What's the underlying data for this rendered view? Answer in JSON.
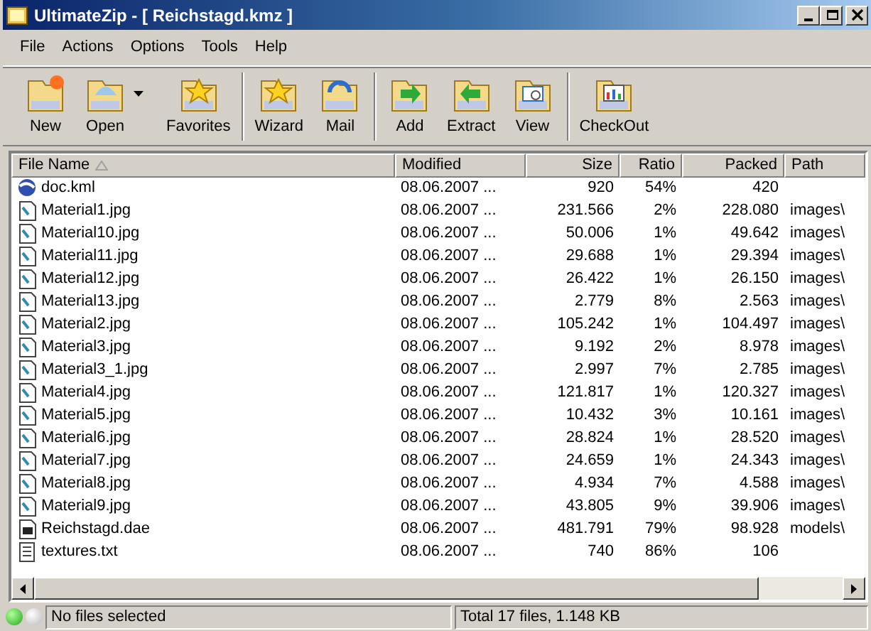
{
  "window": {
    "title": "UltimateZip - [ Reichstagd.kmz ]"
  },
  "menu": [
    "File",
    "Actions",
    "Options",
    "Tools",
    "Help"
  ],
  "toolbar": [
    [
      {
        "label": "New",
        "dropdown": false
      },
      {
        "label": "Open",
        "dropdown": true
      },
      {
        "label": "Favorites",
        "dropdown": false
      }
    ],
    [
      {
        "label": "Wizard",
        "dropdown": false
      },
      {
        "label": "Mail",
        "dropdown": false
      }
    ],
    [
      {
        "label": "Add",
        "dropdown": false
      },
      {
        "label": "Extract",
        "dropdown": false
      },
      {
        "label": "View",
        "dropdown": false
      }
    ],
    [
      {
        "label": "CheckOut",
        "dropdown": false
      }
    ]
  ],
  "table": {
    "columns": [
      {
        "label": "File Name",
        "sorted": true
      },
      {
        "label": "Modified",
        "sorted": false
      },
      {
        "label": "Size",
        "sorted": false
      },
      {
        "label": "Ratio",
        "sorted": false
      },
      {
        "label": "Packed",
        "sorted": false
      },
      {
        "label": "Path",
        "sorted": false
      }
    ],
    "rows": [
      {
        "kind": "kml",
        "cells": [
          "doc.kml",
          "08.06.2007 ...",
          "920",
          "54%",
          "420",
          null
        ]
      },
      {
        "kind": "jpg",
        "cells": [
          "Material1.jpg",
          "08.06.2007 ...",
          "231.566",
          "2%",
          "228.080",
          "images\\"
        ]
      },
      {
        "kind": "jpg",
        "cells": [
          "Material10.jpg",
          "08.06.2007 ...",
          "50.006",
          "1%",
          "49.642",
          "images\\"
        ]
      },
      {
        "kind": "jpg",
        "cells": [
          "Material11.jpg",
          "08.06.2007 ...",
          "29.688",
          "1%",
          "29.394",
          "images\\"
        ]
      },
      {
        "kind": "jpg",
        "cells": [
          "Material12.jpg",
          "08.06.2007 ...",
          "26.422",
          "1%",
          "26.150",
          "images\\"
        ]
      },
      {
        "kind": "jpg",
        "cells": [
          "Material13.jpg",
          "08.06.2007 ...",
          "2.779",
          "8%",
          "2.563",
          "images\\"
        ]
      },
      {
        "kind": "jpg",
        "cells": [
          "Material2.jpg",
          "08.06.2007 ...",
          "105.242",
          "1%",
          "104.497",
          "images\\"
        ]
      },
      {
        "kind": "jpg",
        "cells": [
          "Material3.jpg",
          "08.06.2007 ...",
          "9.192",
          "2%",
          "8.978",
          "images\\"
        ]
      },
      {
        "kind": "jpg",
        "cells": [
          "Material3_1.jpg",
          "08.06.2007 ...",
          "2.997",
          "7%",
          "2.785",
          "images\\"
        ]
      },
      {
        "kind": "jpg",
        "cells": [
          "Material4.jpg",
          "08.06.2007 ...",
          "121.817",
          "1%",
          "120.327",
          "images\\"
        ]
      },
      {
        "kind": "jpg",
        "cells": [
          "Material5.jpg",
          "08.06.2007 ...",
          "10.432",
          "3%",
          "10.161",
          "images\\"
        ]
      },
      {
        "kind": "jpg",
        "cells": [
          "Material6.jpg",
          "08.06.2007 ...",
          "28.824",
          "1%",
          "28.520",
          "images\\"
        ]
      },
      {
        "kind": "jpg",
        "cells": [
          "Material7.jpg",
          "08.06.2007 ...",
          "24.659",
          "1%",
          "24.343",
          "images\\"
        ]
      },
      {
        "kind": "jpg",
        "cells": [
          "Material8.jpg",
          "08.06.2007 ...",
          "4.934",
          "7%",
          "4.588",
          "images\\"
        ]
      },
      {
        "kind": "jpg",
        "cells": [
          "Material9.jpg",
          "08.06.2007 ...",
          "43.805",
          "9%",
          "39.906",
          "images\\"
        ]
      },
      {
        "kind": "dae",
        "cells": [
          "Reichstagd.dae",
          "08.06.2007 ...",
          "481.791",
          "79%",
          "98.928",
          "models\\"
        ]
      },
      {
        "kind": "txt",
        "cells": [
          "textures.txt",
          "08.06.2007 ...",
          "740",
          "86%",
          "106",
          null
        ]
      }
    ]
  },
  "status_bar": {
    "lights": [
      {
        "on": true
      },
      {
        "on": false
      }
    ],
    "selection": "No files selected",
    "total": "Total 17 files, 1.148 KB"
  }
}
